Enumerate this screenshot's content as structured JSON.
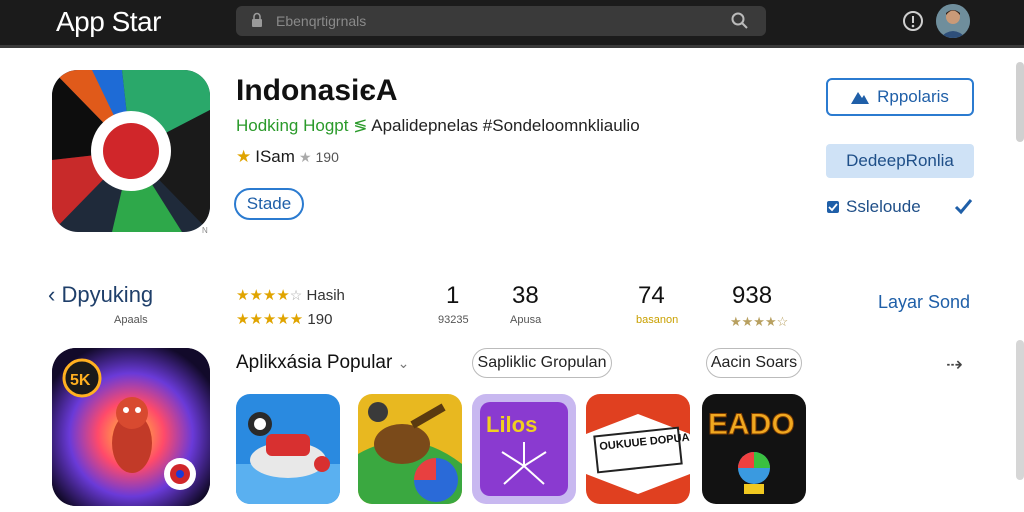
{
  "header": {
    "brand": "App Star",
    "search_placeholder": "Ebenqrtigrnals",
    "icons": [
      "lock-icon",
      "search-icon",
      "info-icon",
      "avatar"
    ]
  },
  "app": {
    "title": "IndonasiєA",
    "subtitle_green": "Hodking Hogpt",
    "subtitle_sep": "≶",
    "subtitle_rest": "Apalidepnelas #Sondeloomnkliaulio",
    "rating_label": "ISam",
    "rating_count": "190",
    "stade_button": "Stade",
    "tiny_mark": "N"
  },
  "actions": {
    "primary_outline": "Rppolaris",
    "primary_fill": "DedeepRonlia",
    "select_label": "Ssleloude"
  },
  "stats": {
    "back_label": "Dpyuking",
    "back_sub": "Apaals",
    "stat1_label": "Hasih",
    "stat1_count": "190",
    "n1": "1",
    "n1_sub": "93235",
    "n2": "38",
    "n2_sub": "Apusa",
    "n3": "74",
    "n3_sub": "basanon",
    "n4": "938",
    "layar": "Layar Sond"
  },
  "popular": {
    "title": "Aplikxásia Popular",
    "pill1": "Sapliklic Gropulan",
    "pill2": "Aacin Soars",
    "arrow": "⇢",
    "tiles": [
      {
        "name": "plane-game"
      },
      {
        "name": "adventure-game"
      },
      {
        "name": "Lilos"
      },
      {
        "name": "OUKUUE DOPUAIS"
      },
      {
        "name": "EADO"
      }
    ],
    "big_badge": "5K"
  },
  "colors": {
    "topbar": "#1b1b1b",
    "accent": "#2b7bd0",
    "accent_fill": "#cfe2f6",
    "star": "#e0a400",
    "green": "#2a9a2a"
  }
}
